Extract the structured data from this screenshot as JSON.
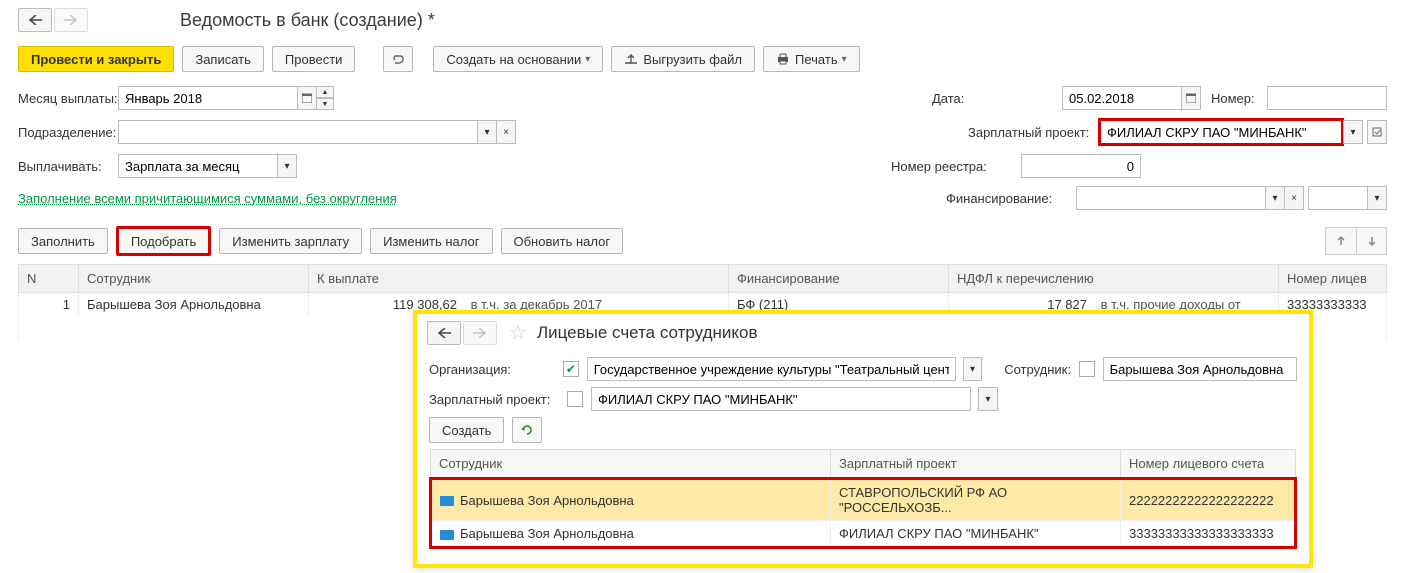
{
  "page": {
    "title": "Ведомость в банк (создание) *"
  },
  "toolbar": {
    "primary": "Провести и закрыть",
    "save": "Записать",
    "post": "Провести",
    "create_base": "Создать на основании",
    "upload": "Выгрузить файл",
    "print": "Печать"
  },
  "form": {
    "month_label": "Месяц выплаты:",
    "month_value": "Январь 2018",
    "date_label": "Дата:",
    "date_value": "05.02.2018",
    "number_label": "Номер:",
    "number_value": "",
    "dept_label": "Подразделение:",
    "dept_value": "",
    "salary_proj_label": "Зарплатный проект:",
    "salary_proj_value": "ФИЛИАЛ СКРУ ПАО \"МИНБАНК\"",
    "pay_label": "Выплачивать:",
    "pay_value": "Зарплата за месяц",
    "registry_no_label": "Номер реестра:",
    "registry_no_value": "0",
    "link_text": "Заполнение всеми причитающимися суммами, без округления",
    "finance_label": "Финансирование:"
  },
  "tb2": {
    "fill": "Заполнить",
    "select": "Подобрать",
    "change_salary": "Изменить зарплату",
    "change_tax": "Изменить налог",
    "update_tax": "Обновить налог"
  },
  "table": {
    "headers": {
      "n": "N",
      "emp": "Сотрудник",
      "topay": "К выплате",
      "fin": "Финансирование",
      "ndfl": "НДФЛ к перечислению",
      "acc": "Номер лицев"
    },
    "rows": [
      {
        "n": "1",
        "emp": "Барышева Зоя Арнольдовна",
        "topay": "119 308,62",
        "topay_note": "в т.ч. за декабрь 2017",
        "fin": "БФ  (211)",
        "ndfl": "17 827",
        "ndfl_note": "в т.ч. прочие доходы от",
        "acc": "33333333333"
      }
    ]
  },
  "popup": {
    "title": "Лицевые счета сотрудников",
    "org_label": "Организация:",
    "org_value": "Государственное учреждение культуры \"Театральный центр\"",
    "emp_label": "Сотрудник:",
    "emp_value": "Барышева Зоя Арнольдовна",
    "proj_label": "Зарплатный проект:",
    "proj_value": "ФИЛИАЛ СКРУ ПАО \"МИНБАНК\"",
    "create": "Создать",
    "headers": {
      "emp": "Сотрудник",
      "proj": "Зарплатный проект",
      "acc": "Номер лицевого счета"
    },
    "rows": [
      {
        "emp": "Барышева Зоя Арнольдовна",
        "proj": "СТАВРОПОЛЬСКИЙ РФ АО \"РОССЕЛЬХОЗБ...",
        "acc": "22222222222222222222"
      },
      {
        "emp": "Барышева Зоя Арнольдовна",
        "proj": "ФИЛИАЛ СКРУ ПАО \"МИНБАНК\"",
        "acc": "33333333333333333333"
      }
    ]
  }
}
